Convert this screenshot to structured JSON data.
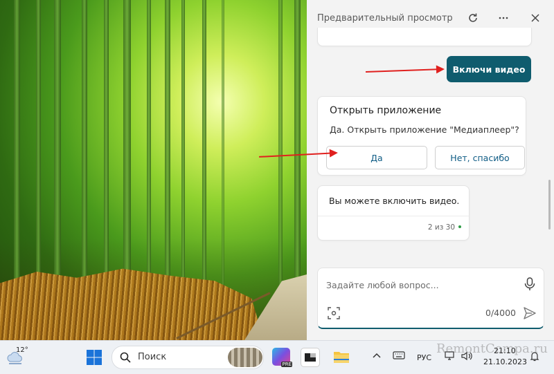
{
  "panel": {
    "title": "Предварительный просмотр",
    "header_icons": [
      "refresh-icon",
      "more-icon",
      "close-icon"
    ]
  },
  "chat": {
    "user_message": "Включи видео",
    "open_app_card": {
      "title": "Открыть приложение",
      "text": "Да. Открыть приложение \"Медиаплеер\"?",
      "yes_label": "Да",
      "no_label": "Нет, спасибо"
    },
    "reply": {
      "text": "Вы можете включить видео.",
      "count": "2 из 30"
    }
  },
  "composer": {
    "placeholder": "Задайте любой вопрос...",
    "char_count": "0/4000"
  },
  "taskbar": {
    "temperature": "12°",
    "search_label": "Поиск",
    "language": "РУС",
    "time": "21:10",
    "date": "21.10.2023"
  },
  "watermark": "RemontCompa.ru",
  "colors": {
    "accent": "#0f5c6e",
    "annotation_arrow": "#e0201e",
    "panel_bg": "#f3f3f3"
  }
}
